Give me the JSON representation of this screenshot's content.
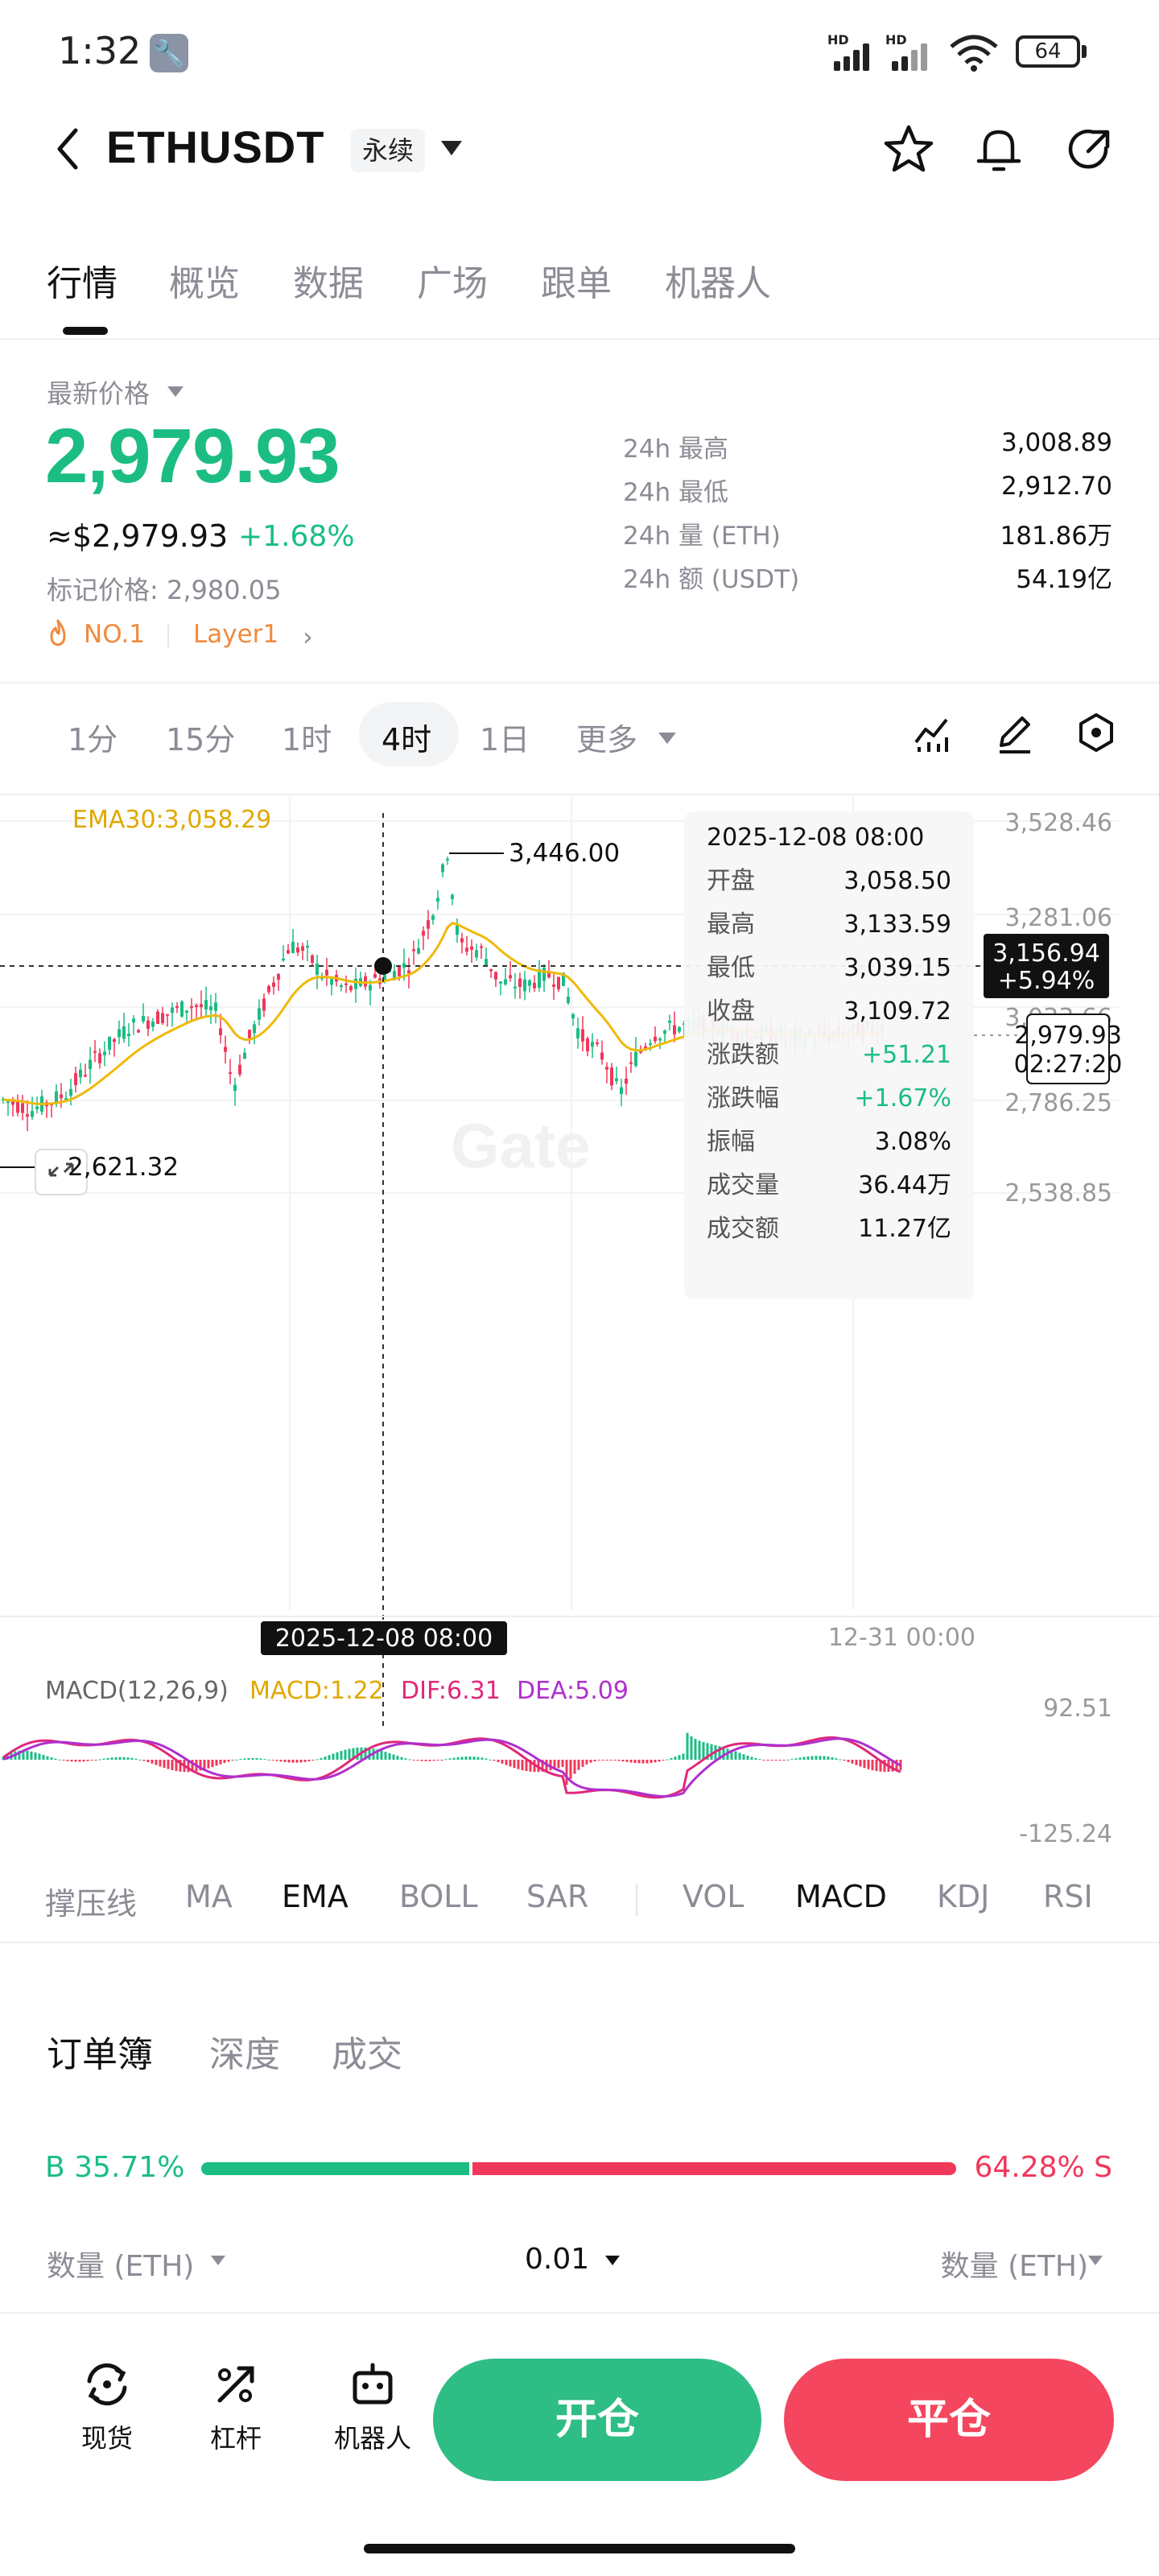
{
  "status_bar": {
    "time": "1:32",
    "signal1_label": "HD",
    "signal2_label": "HD",
    "battery": "64"
  },
  "header": {
    "symbol": "ETHUSDT",
    "contract_type": "永续"
  },
  "tabs": [
    "行情",
    "概览",
    "数据",
    "广场",
    "跟单",
    "机器人"
  ],
  "price": {
    "latest_label": "最新价格",
    "last": "2,979.93",
    "usd": "≈$2,979.93",
    "change_pct": "+1.68%",
    "mark_price": "标记价格: 2,980.05",
    "rank_tag": "NO.1",
    "category_tag": "Layer1"
  },
  "stats": [
    {
      "label": "24h  最高",
      "value": "3,008.89"
    },
    {
      "label": "24h  最低",
      "value": "2,912.70"
    },
    {
      "label": "24h  量 (ETH)",
      "value": "181.86万"
    },
    {
      "label": "24h  额 (USDT)",
      "value": "54.19亿"
    }
  ],
  "intervals": [
    "1分",
    "15分",
    "1时",
    "4时",
    "1日",
    "更多"
  ],
  "active_interval": "4时",
  "chart": {
    "ema_label": "EMA30:3,058.29",
    "price_axis": [
      "3,528.46",
      "3,281.06",
      "3,033.66",
      "2,786.25",
      "2,538.85"
    ],
    "high_marker": "3,446.00",
    "low_marker": "2,621.32",
    "crosshair_price": "3,156.94",
    "crosshair_change": "+5.94%",
    "current_price_tag": "2,979.93",
    "countdown": "02:27:20",
    "crosshair_time": "2025-12-08 08:00",
    "x_axis_label": "12-31 00:00",
    "tooltip": {
      "date": "2025-12-08 08:00",
      "rows": [
        {
          "label": "开盘",
          "value": "3,058.50"
        },
        {
          "label": "最高",
          "value": "3,133.59"
        },
        {
          "label": "最低",
          "value": "3,039.15"
        },
        {
          "label": "收盘",
          "value": "3,109.72"
        },
        {
          "label": "涨跌额",
          "value": "+51.21"
        },
        {
          "label": "涨跌幅",
          "value": "+1.67%"
        },
        {
          "label": "振幅",
          "value": "3.08%"
        },
        {
          "label": "成交量",
          "value": "36.44万"
        },
        {
          "label": "成交额",
          "value": "11.27亿"
        }
      ]
    },
    "macd": {
      "label": "MACD(12,26,9)",
      "macd": "MACD:1.22",
      "dif": "DIF:6.31",
      "dea": "DEA:5.09",
      "axis_top": "92.51",
      "axis_bottom": "-125.24"
    },
    "watermark": "Gate"
  },
  "chart_data": {
    "type": "candlestick",
    "interval": "4h",
    "ylim": [
      2538.85,
      3528.46
    ],
    "series": [
      {
        "name": "EMA30",
        "last": 3058.29
      },
      {
        "name": "MACD",
        "values": {
          "MACD": 1.22,
          "DIF": 6.31,
          "DEA": 5.09
        },
        "ylim": [
          -125.24,
          92.51
        ]
      }
    ],
    "annotations": {
      "high": 3446.0,
      "low": 2621.32,
      "last": 2979.93
    },
    "selected_candle": {
      "time": "2025-12-08 08:00",
      "open": 3058.5,
      "high": 3133.59,
      "low": 3039.15,
      "close": 3109.72
    }
  },
  "indicators": [
    "撑压线",
    "MA",
    "EMA",
    "BOLL",
    "SAR",
    "VOL",
    "MACD",
    "KDJ",
    "RSI"
  ],
  "orderbook": {
    "tabs": [
      "订单簿",
      "深度",
      "成交"
    ],
    "buy_label": "B 35.71%",
    "sell_label": "64.28% S",
    "buy_ratio": 0.3571,
    "qty_left": "数量 (ETH)",
    "precision": "0.01",
    "qty_right": "数量 (ETH)"
  },
  "bottom_nav": {
    "spot": "现货",
    "leverage": "杠杆",
    "bot": "机器人",
    "open": "开仓",
    "close": "平仓"
  },
  "colors": {
    "up": "#1bbd83",
    "down": "#f0385a",
    "ema": "#f0b90b",
    "dea": "#b02fcf",
    "dif": "#e0287a"
  }
}
